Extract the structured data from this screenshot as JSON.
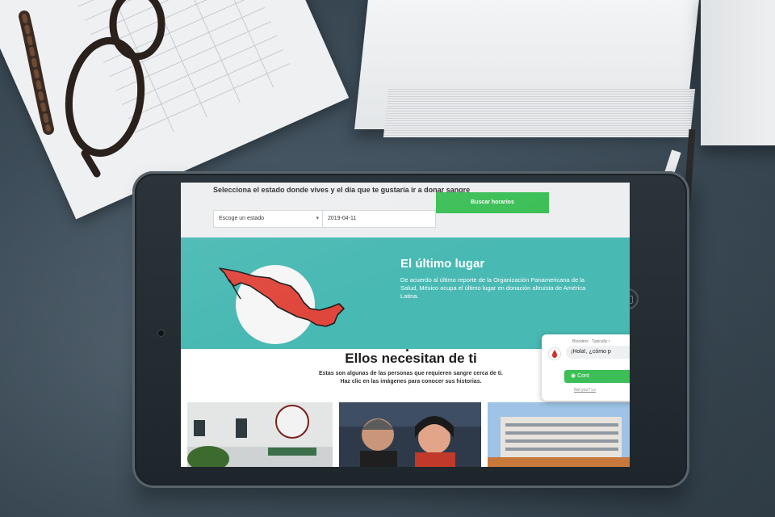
{
  "form": {
    "title": "Selecciona el estado donde vives y el día que te gustaría ir a donar sangre",
    "state_placeholder": "Escoge un estado",
    "date_value": "2019-04-11",
    "search_button": "Buscar horarios"
  },
  "banner": {
    "title": "El último lugar",
    "text": "De acuerdo al último reporte de la Organización Panamericana de la Salud, México ocupa el último lugar en donación altruista de América Latina.",
    "slides_total": 3,
    "slide_active": 3
  },
  "needs": {
    "title": "Ellos necesitan de ti",
    "subtitle_line1": "Estas son algunas de las personas que requieren sangre cerca de ti.",
    "subtitle_line2": "Haz clic en las imágenes para conocer sus historias."
  },
  "chat": {
    "header": "Blooders · Typically r",
    "greeting": "¡Hola!, ¿cómo p",
    "button": "Cont",
    "footer": "Not you? Lo"
  },
  "colors": {
    "teal": "#49b9b3",
    "green": "#3cbf57",
    "mexico_red": "#e0473c"
  }
}
